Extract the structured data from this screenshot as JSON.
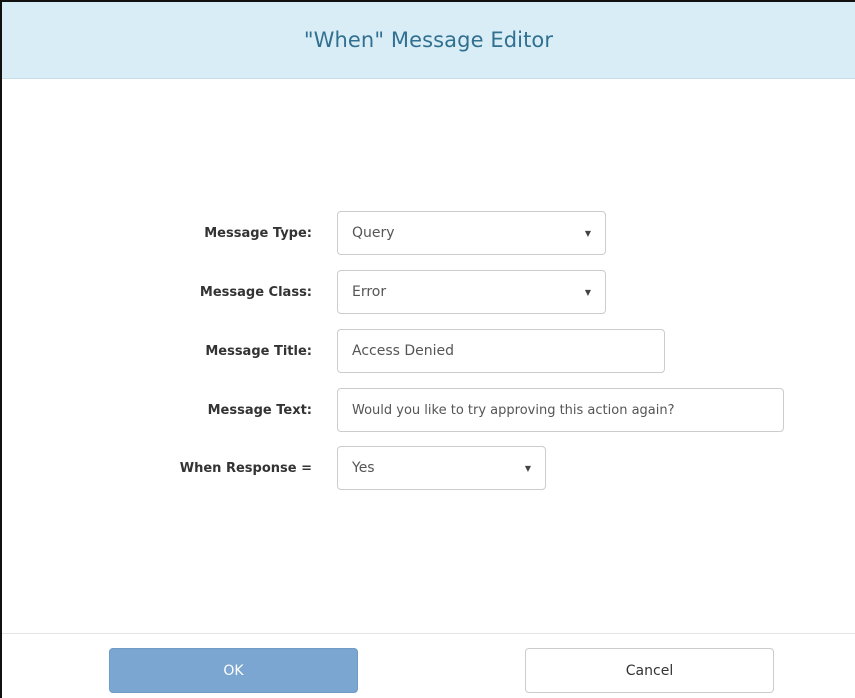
{
  "dialog": {
    "title": "\"When\" Message Editor"
  },
  "form": {
    "message_type": {
      "label": "Message Type:",
      "value": "Query",
      "icon": "caret-down-icon"
    },
    "message_class": {
      "label": "Message Class:",
      "value": "Error",
      "icon": "caret-down-icon"
    },
    "message_title": {
      "label": "Message Title:",
      "value": "Access Denied"
    },
    "message_text": {
      "label": "Message Text:",
      "value": "Would you like to try approving this action again?"
    },
    "when_response": {
      "label": "When Response =",
      "value": "Yes",
      "icon": "caret-down-icon"
    }
  },
  "buttons": {
    "ok_label": "OK",
    "cancel_label": "Cancel"
  },
  "colors": {
    "header_bg": "#d9edf7",
    "header_text": "#31708f",
    "ok_button_bg": "#7ba6d1"
  }
}
